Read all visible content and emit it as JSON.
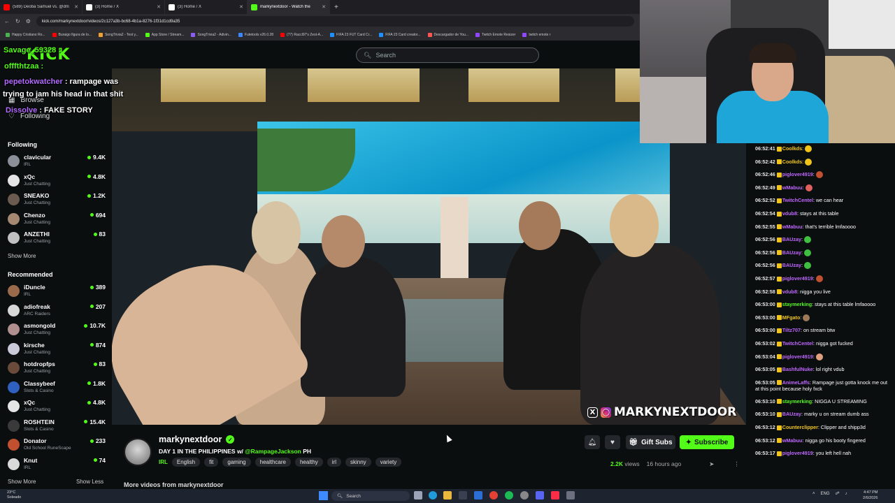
{
  "browser": {
    "tabs": [
      {
        "title": "(589) Deoba Samuel vs. @dm",
        "favicon_color": "#ff0000",
        "active": false
      },
      {
        "title": "(3) Home / X",
        "favicon_color": "#ffffff",
        "active": false
      },
      {
        "title": "(3) Home / X",
        "favicon_color": "#ffffff",
        "active": false
      },
      {
        "title": "markynextdoor - Watch the",
        "favicon_color": "#53fc18",
        "active": true
      }
    ],
    "url": "kick.com/markynextdoor/videos/2c127a3b-bc68-4b1a-8276-1f31d1cd9a35",
    "bookmarks": [
      {
        "label": "Happy Cristiano Ro...",
        "color": "#4caf50"
      },
      {
        "label": "Buraigo figura de lo...",
        "color": "#ff0000"
      },
      {
        "label": "SongTrivia2 - Test y...",
        "color": "#f0a030"
      },
      {
        "label": "App Store / Stream...",
        "color": "#53fc18"
      },
      {
        "label": "SongTrivia2 - Adivin...",
        "color": "#8a5cf6"
      },
      {
        "label": "Futetools v26.0.28",
        "color": "#3a86ff"
      },
      {
        "label": "(77) Raccl97's Zest-A...",
        "color": "#ff0000"
      },
      {
        "label": "FIFA 23 FUT Card Cr...",
        "color": "#1e90ff"
      },
      {
        "label": "FIFA 23 Card creator...",
        "color": "#1e90ff"
      },
      {
        "label": "Descargador de You...",
        "color": "#ff5555"
      },
      {
        "label": "Twitch Emote Resizer",
        "color": "#9146ff"
      },
      {
        "label": "twitch emote r",
        "color": "#9146ff"
      }
    ]
  },
  "kick": {
    "logo": "KICK",
    "search_placeholder": "Search",
    "nav": {
      "browse": "Browse",
      "following": "Following"
    },
    "following_header": "Following",
    "recommended_header": "Recommended",
    "show_more": "Show More",
    "show_less": "Show Less",
    "following": [
      {
        "name": "clavicular",
        "category": "IRL",
        "viewers": "9.4K",
        "color": "#8a8f98"
      },
      {
        "name": "xQc",
        "category": "Just Chatting",
        "viewers": "4.8K",
        "color": "#e5e5e5"
      },
      {
        "name": "SNEAKO",
        "category": "Just Chatting",
        "viewers": "1.2K",
        "color": "#6b5a4f"
      },
      {
        "name": "Chenzo",
        "category": "Just Chatting",
        "viewers": "694",
        "color": "#a48872"
      },
      {
        "name": "ANZETHI",
        "category": "Just Chatting",
        "viewers": "83",
        "color": "#c0c0c0"
      }
    ],
    "recommended": [
      {
        "name": "iDuncle",
        "category": "IRL",
        "viewers": "389",
        "color": "#9b6a4a"
      },
      {
        "name": "adiofreak",
        "category": "ARC Raiders",
        "viewers": "207",
        "color": "#d7d7d7"
      },
      {
        "name": "asmongold",
        "category": "Just Chatting",
        "viewers": "10.7K",
        "color": "#b08f8f"
      },
      {
        "name": "kirsche",
        "category": "Just Chatting",
        "viewers": "874",
        "color": "#c9c9d9"
      },
      {
        "name": "hotdropfps",
        "category": "Just Chatting",
        "viewers": "83",
        "color": "#6a4a3a"
      },
      {
        "name": "Classybeef",
        "category": "Slots & Casino",
        "viewers": "1.8K",
        "color": "#2f5fbf"
      },
      {
        "name": "xQc",
        "category": "Just Chatting",
        "viewers": "4.8K",
        "color": "#e5e5e5"
      },
      {
        "name": "ROSHTEIN",
        "category": "Slots & Casino",
        "viewers": "15.4K",
        "color": "#3a3a3a"
      },
      {
        "name": "Donator",
        "category": "Old School RuneScape",
        "viewers": "233",
        "color": "#c05030"
      },
      {
        "name": "Knut",
        "category": "IRL",
        "viewers": "74",
        "color": "#d9d9d9"
      }
    ]
  },
  "overlay_chat": [
    {
      "user": "Savage_59328",
      "text": "",
      "color": "#53fc18"
    },
    {
      "user": "offfthtzaa",
      "text": "",
      "color": "#53fc18"
    },
    {
      "user": "pepetokwatcher",
      "text": "rampage was",
      "color": "#b36bff"
    },
    {
      "user": "",
      "text": "trying to jam his head in that shit",
      "color": "#ffffff"
    },
    {
      "user": "Dissolve",
      "text": "FAKE STORY",
      "color": "#b36bff"
    }
  ],
  "video": {
    "watermark": "MARKYNEXTDOOR"
  },
  "stream": {
    "streamer": "markynextdoor",
    "title_prefix": "DAY 1 IN THE PHILIPPINES w/",
    "title_mention": "@RampageJackson",
    "title_suffix": "PH",
    "category": "IRL",
    "tags": [
      "English",
      "fit",
      "gaming",
      "healthcare",
      "healthy",
      "irl",
      "skinny",
      "variety"
    ],
    "gift_label": "Gift Subs",
    "subscribe_label": "Subscribe",
    "views": "2.2K",
    "views_label": "views",
    "age": "16 hours ago",
    "more_videos": "More videos from markynextdoor"
  },
  "chat": [
    {
      "time": "06:52:41",
      "user": "Coolkds",
      "color": "#f0c419",
      "text": "",
      "emote": "#f0c419"
    },
    {
      "time": "06:52:42",
      "user": "Coolkds",
      "color": "#f0c419",
      "text": "",
      "emote": "#f0c419"
    },
    {
      "time": "06:52:46",
      "user": "piglover4919",
      "color": "#c067ff",
      "text": "",
      "emote": "#c05030"
    },
    {
      "time": "06:52:49",
      "user": "wMabuu",
      "color": "#c067ff",
      "text": "",
      "emote": "#e06060"
    },
    {
      "time": "06:52:52",
      "user": "TwitchCentel",
      "color": "#c067ff",
      "text": "we can hear",
      "emote": ""
    },
    {
      "time": "06:52:54",
      "user": "vdub8",
      "color": "#c067ff",
      "text": "stays at this table",
      "emote": ""
    },
    {
      "time": "06:52:55",
      "user": "wMabuu",
      "color": "#c067ff",
      "text": "that's terrible lmfaoooo",
      "emote": ""
    },
    {
      "time": "06:52:56",
      "user": "BAUzay",
      "color": "#c067ff",
      "text": "",
      "emote": "#3fbf3f"
    },
    {
      "time": "06:52:56",
      "user": "BAUzay",
      "color": "#c067ff",
      "text": "",
      "emote": "#3fbf3f"
    },
    {
      "time": "06:52:56",
      "user": "BAUzay",
      "color": "#c067ff",
      "text": "",
      "emote": "#3fbf3f"
    },
    {
      "time": "06:52:57",
      "user": "piglover4919",
      "color": "#c067ff",
      "text": "",
      "emote": "#c05030"
    },
    {
      "time": "06:52:58",
      "user": "vdub8",
      "color": "#c067ff",
      "text": "nigga you live",
      "emote": ""
    },
    {
      "time": "06:53:00",
      "user": "staymerking",
      "color": "#53fc18",
      "text": "stays at this table lmfaoooo",
      "emote": ""
    },
    {
      "time": "06:53:00",
      "user": "MFgato",
      "color": "#f0c419",
      "text": "",
      "emote": "#9b7a5a"
    },
    {
      "time": "06:53:00",
      "user": "Tiltz707",
      "color": "#c067ff",
      "text": "on stream btw",
      "emote": ""
    },
    {
      "time": "06:53:02",
      "user": "TwitchCentel",
      "color": "#c067ff",
      "text": "nigga got fucked",
      "emote": ""
    },
    {
      "time": "06:53:04",
      "user": "piglover4919",
      "color": "#c067ff",
      "text": "",
      "emote": "#e0a080"
    },
    {
      "time": "06:53:05",
      "user": "BashfulNuke",
      "color": "#c067ff",
      "text": "lol right vdub",
      "emote": ""
    },
    {
      "time": "06:53:05",
      "user": "AnimeLaffs",
      "color": "#c067ff",
      "text": "Rampage just gotta knock me out at this point because holy fxck",
      "emote": ""
    },
    {
      "time": "06:53:10",
      "user": "staymerking",
      "color": "#53fc18",
      "text": "NIGGA U STREAMING",
      "emote": ""
    },
    {
      "time": "06:53:10",
      "user": "BAUzay",
      "color": "#c067ff",
      "text": "marky u on stream dumb ass",
      "emote": ""
    },
    {
      "time": "06:53:12",
      "user": "Counterclipper",
      "color": "#f0c419",
      "text": "Clipper and shipp3d",
      "emote": ""
    },
    {
      "time": "06:53:12",
      "user": "wMabuu",
      "color": "#c067ff",
      "text": "nigga go his booty fingered",
      "emote": ""
    },
    {
      "time": "06:53:17",
      "user": "piglover4919",
      "color": "#c067ff",
      "text": "you left hell nah",
      "emote": ""
    }
  ],
  "taskbar": {
    "weather_temp": "23°C",
    "weather_desc": "Soleado",
    "search_label": "Search",
    "language": "ENG",
    "time": "4:47 PM",
    "date": "2/6/2026"
  }
}
